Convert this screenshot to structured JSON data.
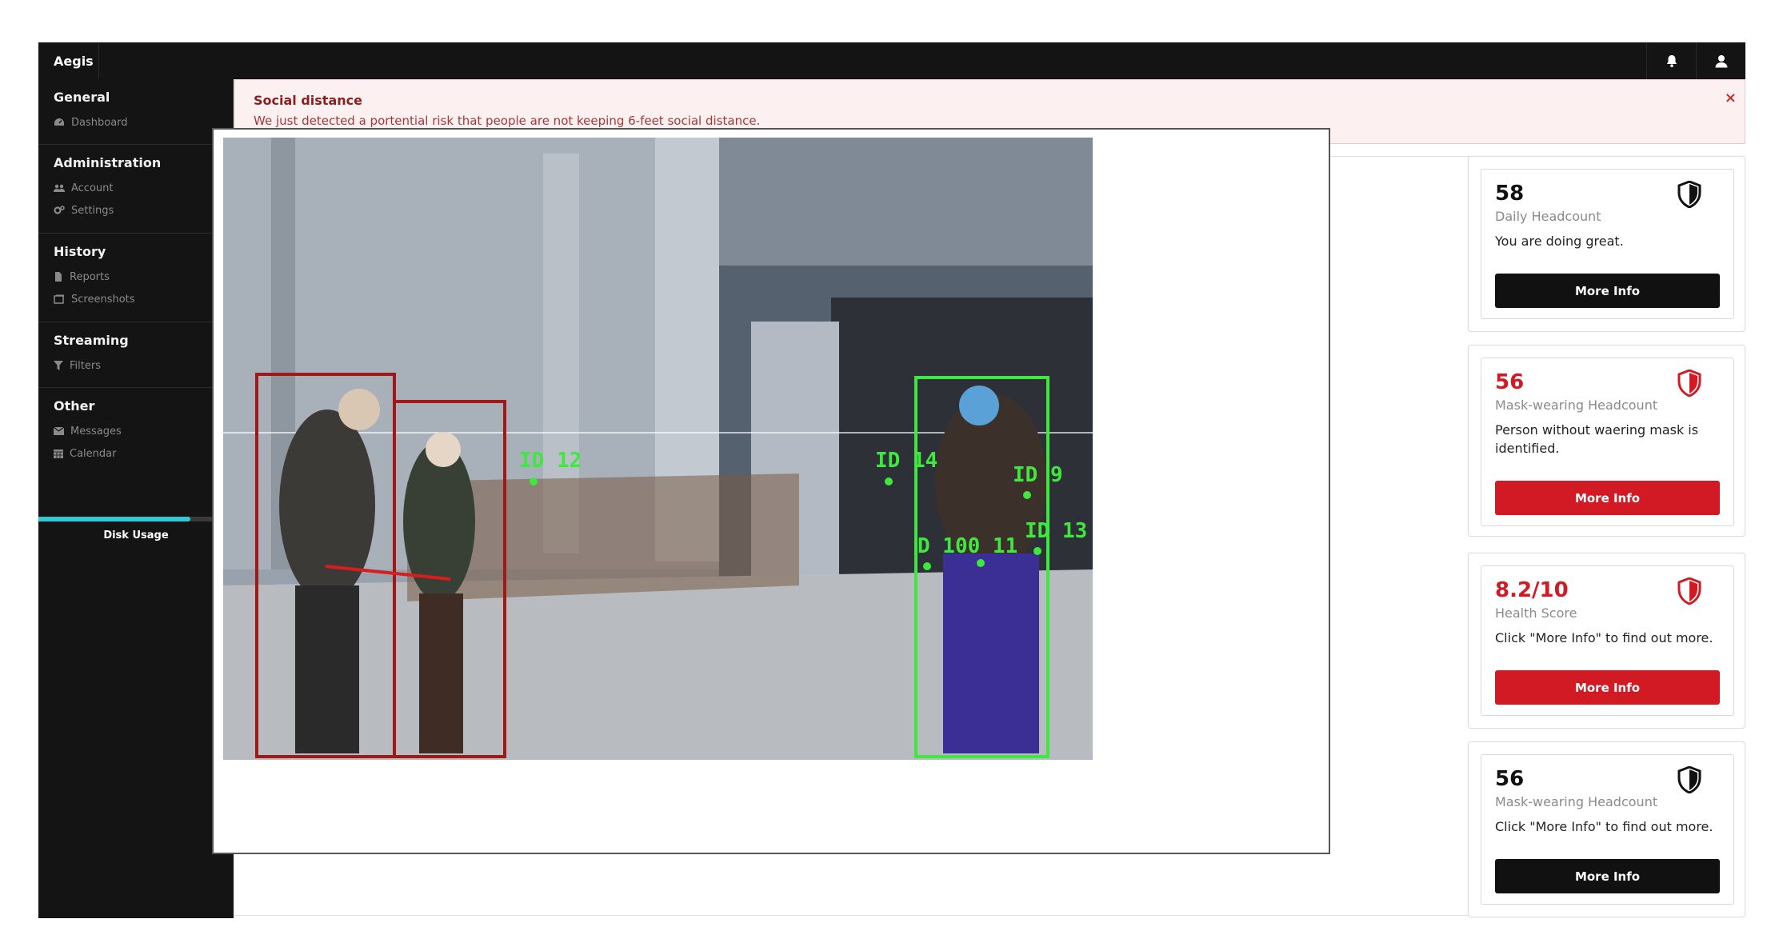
{
  "app": {
    "title": "Aegis"
  },
  "sidebar": {
    "sections": [
      {
        "title": "General",
        "items": [
          {
            "label": "Dashboard",
            "icon": "dashboard-icon"
          }
        ]
      },
      {
        "title": "Administration",
        "items": [
          {
            "label": "Account",
            "icon": "users-icon"
          },
          {
            "label": "Settings",
            "icon": "gears-icon"
          }
        ]
      },
      {
        "title": "History",
        "items": [
          {
            "label": "Reports",
            "icon": "file-icon"
          },
          {
            "label": "Screenshots",
            "icon": "images-icon"
          }
        ]
      },
      {
        "title": "Streaming",
        "items": [
          {
            "label": "Filters",
            "icon": "filter-icon"
          }
        ]
      },
      {
        "title": "Other",
        "items": [
          {
            "label": "Messages",
            "icon": "envelope-icon"
          },
          {
            "label": "Calendar",
            "icon": "calendar-icon"
          }
        ]
      }
    ],
    "disk_usage": {
      "label": "Disk Usage",
      "fill_fraction": 0.78,
      "color": "#35c6d6"
    }
  },
  "alert": {
    "title": "Social distance",
    "message": "We just detected a portential risk that people are not keeping 6-feet social distance.",
    "close": "×"
  },
  "video": {
    "detections": [
      {
        "label": "ID 12",
        "color": "#3ee83e"
      },
      {
        "label": "ID 14",
        "color": "#3ee83e"
      },
      {
        "label": "ID 9",
        "color": "#3ee83e"
      },
      {
        "label": "ID 13",
        "color": "#3ee83e"
      },
      {
        "label": "D 100 11",
        "color": "#3ee83e"
      }
    ]
  },
  "cards": [
    {
      "value": "58",
      "label": "Daily Headcount",
      "message": "You are doing great.",
      "button": "More Info",
      "tone": "black"
    },
    {
      "value": "56",
      "label": "Mask-wearing Headcount",
      "message": "Person without waering mask is identified.",
      "button": "More Info",
      "tone": "red"
    },
    {
      "value": "8.2/10",
      "label": "Health Score",
      "message": "Click \"More Info\" to find out more.",
      "button": "More Info",
      "tone": "red"
    },
    {
      "value": "56",
      "label": "Mask-wearing Headcount",
      "message": "Click \"More Info\" to find out more.",
      "button": "More Info",
      "tone": "black"
    }
  ],
  "colors": {
    "accent_red": "#d11a24",
    "dark": "#141414",
    "detect_green": "#3ee83e",
    "detect_red": "#a01818"
  }
}
